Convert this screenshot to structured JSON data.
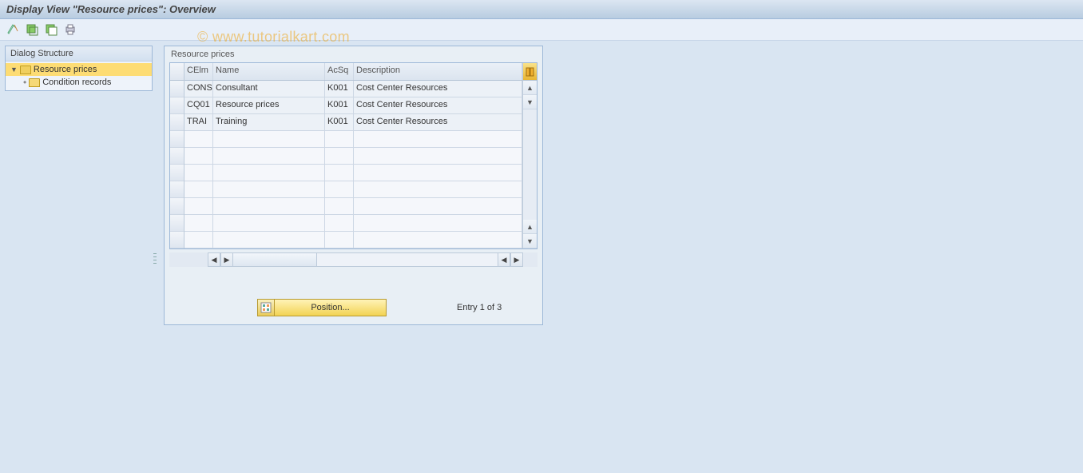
{
  "title": "Display View \"Resource prices\": Overview",
  "watermark": "© www.tutorialkart.com",
  "tree": {
    "header": "Dialog Structure",
    "root_label": "Resource prices",
    "child_label": "Condition records"
  },
  "table": {
    "caption": "Resource prices",
    "columns": {
      "celm": "CElm",
      "name": "Name",
      "acsq": "AcSq",
      "desc": "Description"
    },
    "rows": [
      {
        "celm": "CONS",
        "name": "Consultant",
        "acsq": "K001",
        "desc": "Cost Center Resources"
      },
      {
        "celm": "CQ01",
        "name": "Resource prices",
        "acsq": "K001",
        "desc": "Cost Center Resources"
      },
      {
        "celm": "TRAI",
        "name": "Training",
        "acsq": "K001",
        "desc": "Cost Center Resources"
      }
    ]
  },
  "footer": {
    "position_button": "Position...",
    "entry_status": "Entry 1 of 3"
  }
}
